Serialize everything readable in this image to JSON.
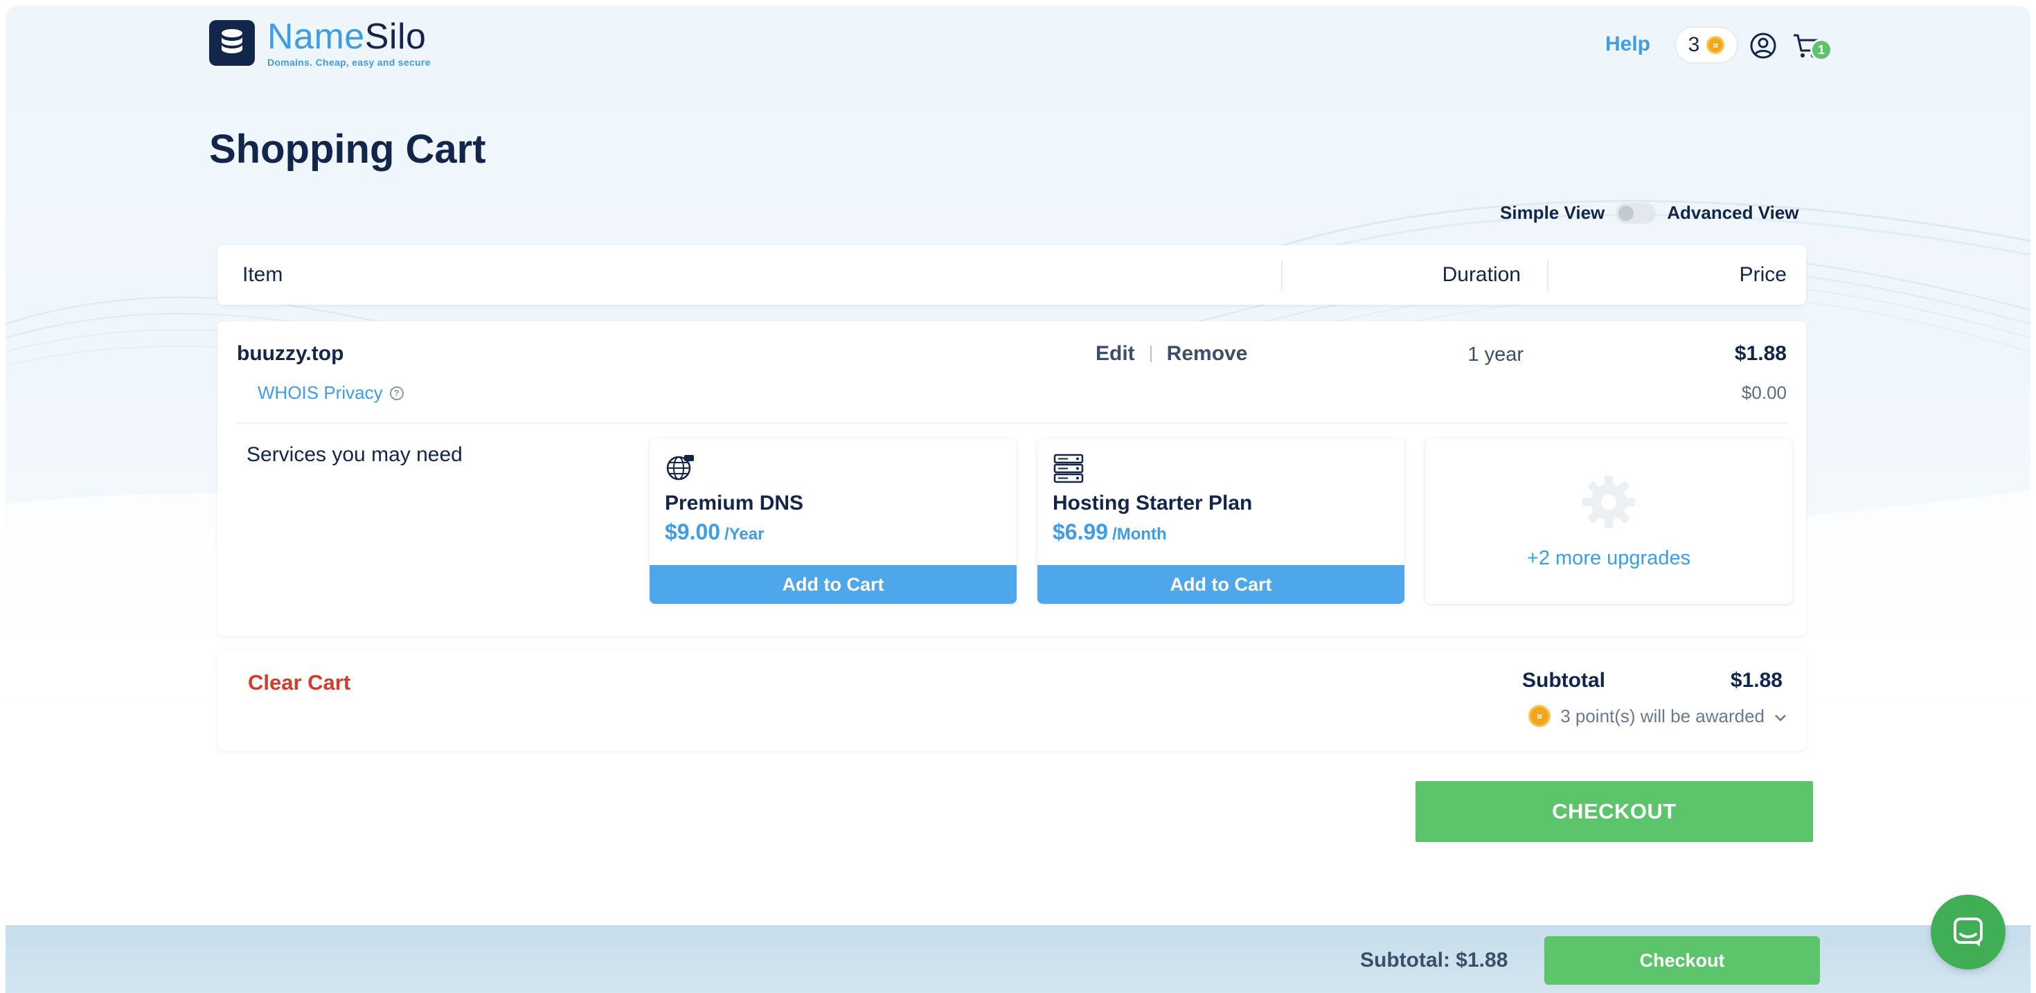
{
  "header": {
    "logo": {
      "name_part1": "Name",
      "name_part2": "Silo",
      "tagline": "Domains. Cheap, easy and secure"
    },
    "help_label": "Help",
    "points": "3",
    "cart_count": "1"
  },
  "page_title": "Shopping Cart",
  "view_toggle": {
    "simple_label": "Simple View",
    "advanced_label": "Advanced View",
    "advanced_enabled": false
  },
  "table_header": {
    "item": "Item",
    "duration": "Duration",
    "price": "Price"
  },
  "cart_item": {
    "domain": "buuzzy.top",
    "edit_label": "Edit",
    "remove_label": "Remove",
    "duration": "1 year",
    "price": "$1.88",
    "addon_label": "WHOIS Privacy",
    "addon_price": "$0.00"
  },
  "services": {
    "label": "Services you may need",
    "items": [
      {
        "name": "Premium DNS",
        "price": "$9.00",
        "period": "/Year",
        "button": "Add to Cart",
        "icon": "globe-icon"
      },
      {
        "name": "Hosting Starter Plan",
        "price": "$6.99",
        "period": "/Month",
        "button": "Add to Cart",
        "icon": "server-icon"
      }
    ],
    "more_label": "+2 more upgrades"
  },
  "summary": {
    "clear_cart": "Clear Cart",
    "subtotal_label": "Subtotal",
    "subtotal_value": "$1.88",
    "points_awarded": "3 point(s) will be awarded"
  },
  "checkout_label": "CHECKOUT",
  "bottom_bar": {
    "subtotal": "Subtotal: $1.88",
    "checkout_label": "Checkout"
  },
  "colors": {
    "accent_blue": "#3d9de6",
    "navy": "#12254a",
    "green": "#5cc46a",
    "danger": "#d23c2a"
  }
}
